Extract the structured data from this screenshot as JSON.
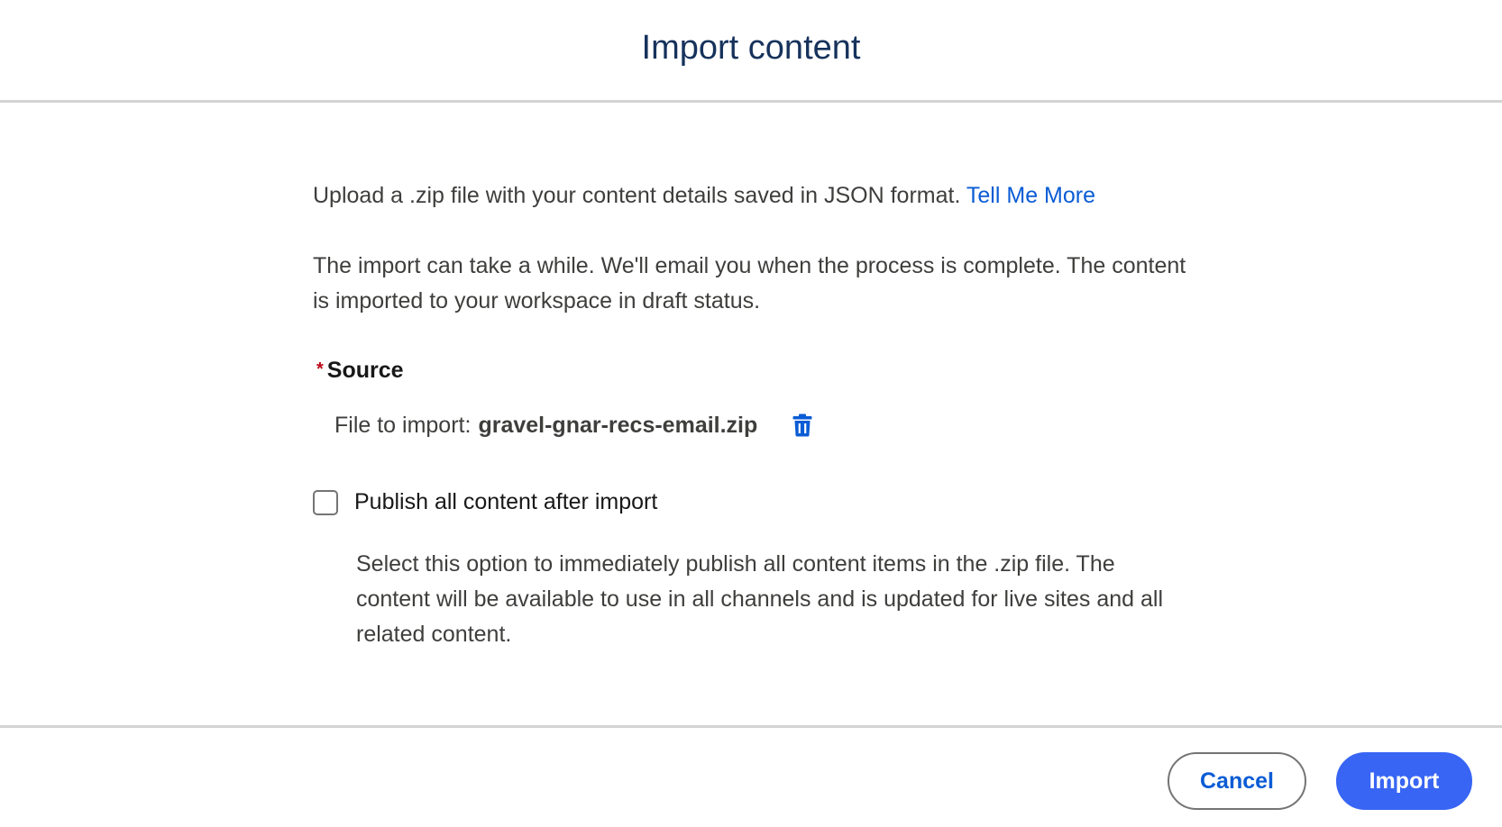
{
  "modal": {
    "title": "Import content"
  },
  "intro": {
    "text": "Upload a .zip file with your content details saved in JSON format.",
    "link_label": "Tell Me More"
  },
  "note": {
    "text": "The import can take a while. We'll email you when the process is complete. The content is imported to your workspace in draft status."
  },
  "source": {
    "required_marker": "*",
    "label": "Source",
    "file_prefix": "File to import:",
    "file_name": "gravel-gnar-recs-email.zip",
    "delete_icon": "trash-icon"
  },
  "publish_option": {
    "label": "Publish all content after import",
    "checked": false,
    "help": "Select this option to immediately publish all content items in the .zip file. The content will be available to use in all channels and is updated for live sites and all related content."
  },
  "footer": {
    "cancel_label": "Cancel",
    "import_label": "Import"
  },
  "colors": {
    "title": "#16325c",
    "link": "#0b5cd5",
    "required": "#ba0517",
    "primary_button": "#3865f4"
  }
}
